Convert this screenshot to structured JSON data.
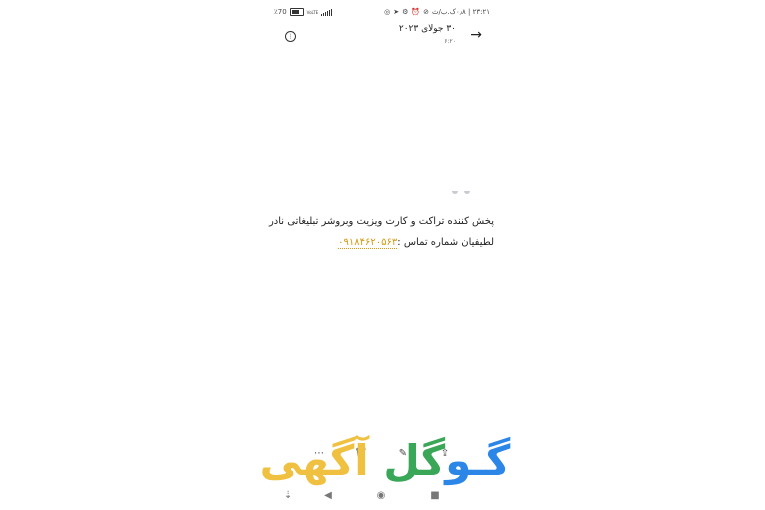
{
  "status_bar": {
    "battery_text": "٪70",
    "network_text": "VoLTE",
    "time_text": "۲۳:۲۱ | ۰٫۸ک.ب/ث",
    "left_icons": [
      "battery-icon",
      "signal-icon"
    ],
    "right_icons": [
      "whatsapp-icon",
      "telegram-icon",
      "location-icon",
      "alarm-icon",
      "mute-icon"
    ]
  },
  "header": {
    "title": "۳۰ جولای ۲۰۲۳",
    "subtitle": "۶:۲۰",
    "back_icon": "arrow-right-icon",
    "menu_icon": "menu-dots-icon"
  },
  "message": {
    "line1": "پخش کننده تراکت و کارت ویزیت وبروشر  تبلیغاتی نادر",
    "line2_prefix": "لطیفیان شماره تماس :",
    "phone": "۰۹۱۸۴۶۲۰۵۶۳"
  },
  "toolbar": {
    "icons": [
      "share-icon",
      "edit-icon",
      "delete-icon",
      "more-icon"
    ]
  },
  "watermark": {
    "part1": "گـو",
    "part2": "گل",
    "part3": " آگهی",
    "colors": [
      "#2c86e8",
      "#e54b3c",
      "#3aa657",
      "#f0c040"
    ]
  },
  "nav_bar": {
    "icons": [
      "nav-down-icon",
      "nav-back-icon",
      "nav-home-icon",
      "nav-recents-icon"
    ]
  }
}
